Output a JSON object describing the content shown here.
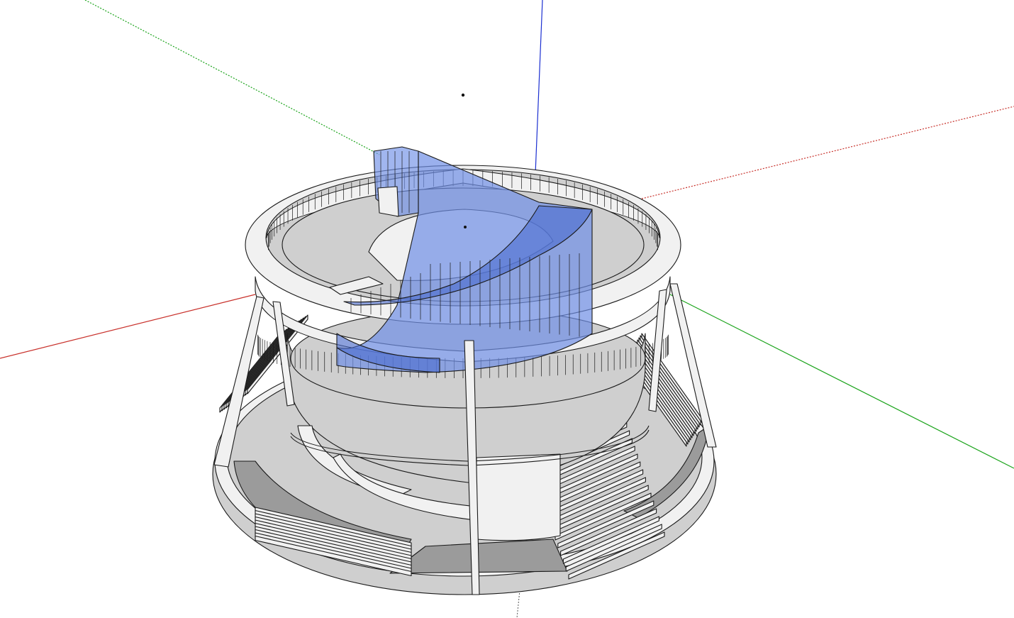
{
  "app": {
    "view": "3d-model-viewport",
    "background": "#ffffff"
  },
  "axes": {
    "red": "#c8312b",
    "green": "#1aa31a",
    "blue": "#1b2fd1"
  },
  "model": {
    "type": "circular-amphitheater-with-glass-ramp",
    "colors": {
      "face_light": "#f1f1f1",
      "face_mid": "#cfcfcf",
      "face_dark": "#9b9b9b",
      "glass": "#6f8fe6",
      "glass_dark": "#4a6bcf",
      "edge": "#1a1a1a"
    },
    "stair_blocks": 4,
    "support_columns": 4
  }
}
